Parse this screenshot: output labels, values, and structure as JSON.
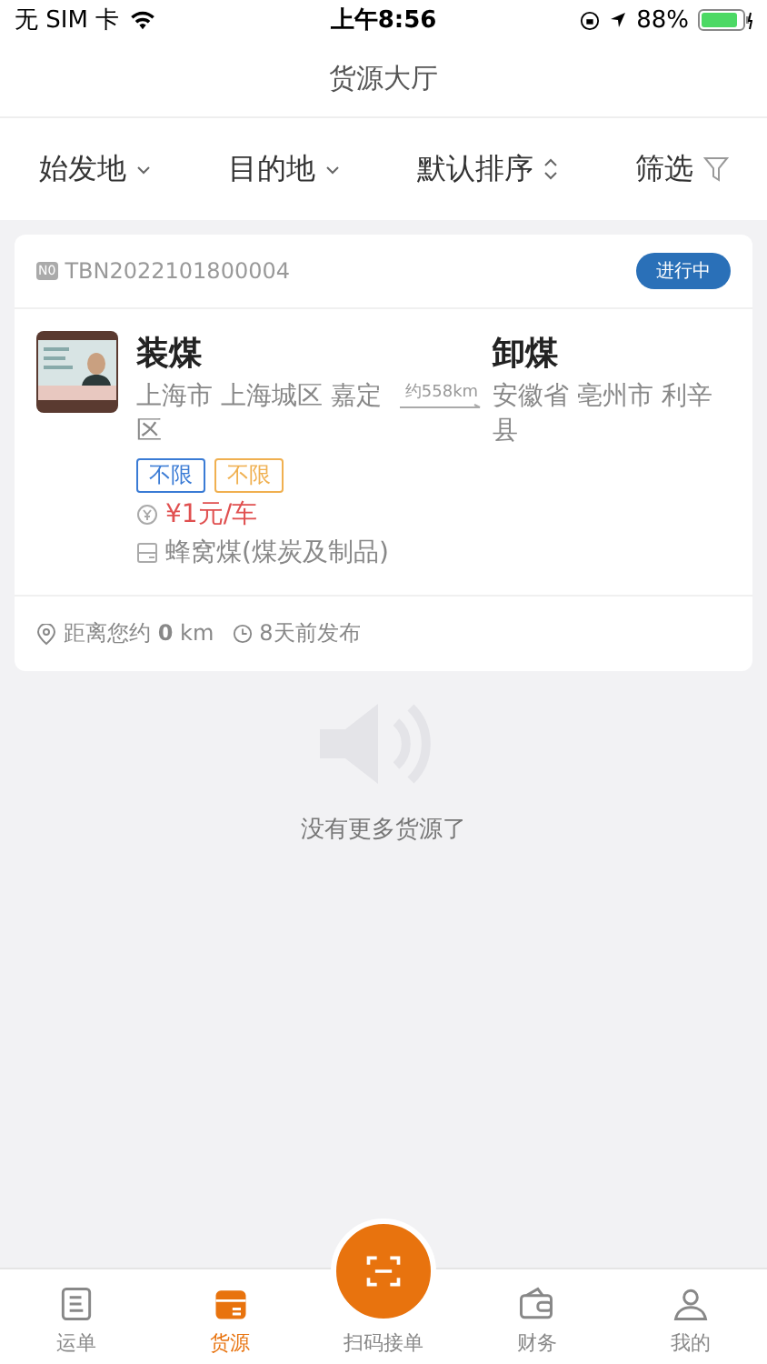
{
  "status_bar": {
    "carrier": "无 SIM 卡",
    "time": "上午8:56",
    "battery": "88%"
  },
  "nav": {
    "title": "货源大厅"
  },
  "filters": [
    {
      "label": "始发地",
      "kind": "dropdown"
    },
    {
      "label": "目的地",
      "kind": "dropdown"
    },
    {
      "label": "默认排序",
      "kind": "sort"
    },
    {
      "label": "筛选",
      "kind": "filter"
    }
  ],
  "cards": [
    {
      "number_badge": "N0",
      "number": "TBN2022101800004",
      "status": "进行中",
      "load": {
        "title": "装煤",
        "address": "上海市 上海城区 嘉定区"
      },
      "distance": "约558km",
      "unload": {
        "title": "卸煤",
        "address": "安徽省 亳州市 利辛县"
      },
      "tags": [
        {
          "label": "不限",
          "color": "#3a7bd5"
        },
        {
          "label": "不限",
          "color": "#f0b050"
        }
      ],
      "price": "¥1元/车",
      "goods": "蜂窝煤(煤炭及制品)",
      "near": "距离您约 **0** km",
      "posted": "8天前发布"
    }
  ],
  "empty_text": "没有更多货源了",
  "tabbar": [
    {
      "label": "运单",
      "kind": "waybill",
      "selected": false
    },
    {
      "label": "货源",
      "kind": "cargo",
      "selected": true
    },
    {
      "label": "扫码接单",
      "kind": "scan",
      "selected": false
    },
    {
      "label": "财务",
      "kind": "wallet",
      "selected": false
    },
    {
      "label": "我的",
      "kind": "user",
      "selected": false
    }
  ]
}
